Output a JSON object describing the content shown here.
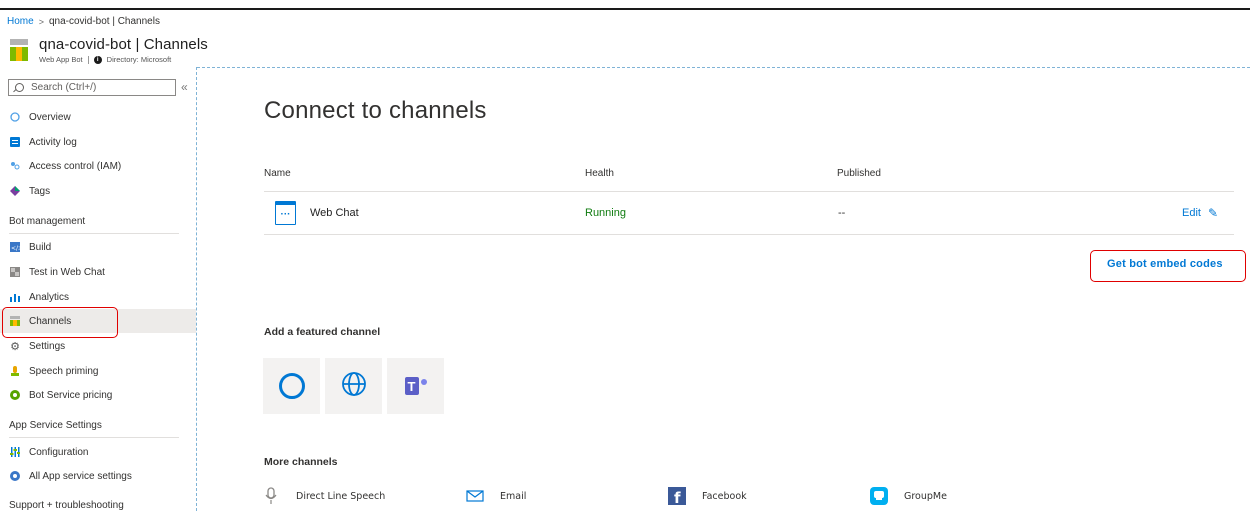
{
  "breadcrumb": {
    "home": "Home",
    "separator": ">",
    "current": "qna-covid-bot | Channels"
  },
  "resource": {
    "title": "qna-covid-bot | Channels",
    "type": "Web App Bot",
    "directory": "Directory: Microsoft"
  },
  "sidebar": {
    "search_placeholder": "Search (Ctrl+/)",
    "collapse": "«",
    "items_top": [
      {
        "label": "Overview",
        "icon": "overview-icon"
      },
      {
        "label": "Activity log",
        "icon": "activity-log-icon"
      },
      {
        "label": "Access control (IAM)",
        "icon": "iam-icon"
      },
      {
        "label": "Tags",
        "icon": "tag-icon"
      }
    ],
    "section_bot_management": "Bot management",
    "items_bot": [
      {
        "label": "Build",
        "icon": "code-icon"
      },
      {
        "label": "Test in Web Chat",
        "icon": "webchat-test-icon"
      },
      {
        "label": "Analytics",
        "icon": "analytics-icon"
      },
      {
        "label": "Channels",
        "icon": "channels-icon"
      },
      {
        "label": "Settings",
        "icon": "gear-icon"
      },
      {
        "label": "Speech priming",
        "icon": "speech-icon"
      },
      {
        "label": "Bot Service pricing",
        "icon": "pricing-icon"
      }
    ],
    "section_app_service": "App Service Settings",
    "items_app": [
      {
        "label": "Configuration",
        "icon": "sliders-icon"
      },
      {
        "label": "All App service settings",
        "icon": "app-service-icon"
      }
    ],
    "section_support": "Support + troubleshooting"
  },
  "main": {
    "heading": "Connect to channels",
    "columns": {
      "name": "Name",
      "health": "Health",
      "published": "Published"
    },
    "channel_row": {
      "name": "Web Chat",
      "health": "Running",
      "published": "--",
      "edit": "Edit"
    },
    "embed_link": "Get bot embed codes",
    "featured_title": "Add a featured channel",
    "featured": [
      "cortana-icon",
      "globe-icon",
      "teams-icon"
    ],
    "more_title": "More channels",
    "more": [
      {
        "label": "Direct Line Speech",
        "icon": "microphone-icon"
      },
      {
        "label": "Email",
        "icon": "email-icon"
      },
      {
        "label": "Facebook",
        "icon": "facebook-icon"
      },
      {
        "label": "GroupMe",
        "icon": "groupme-icon"
      }
    ]
  },
  "colors": {
    "accent": "#0078d4",
    "running": "#107c10",
    "highlight": "#e00000"
  }
}
